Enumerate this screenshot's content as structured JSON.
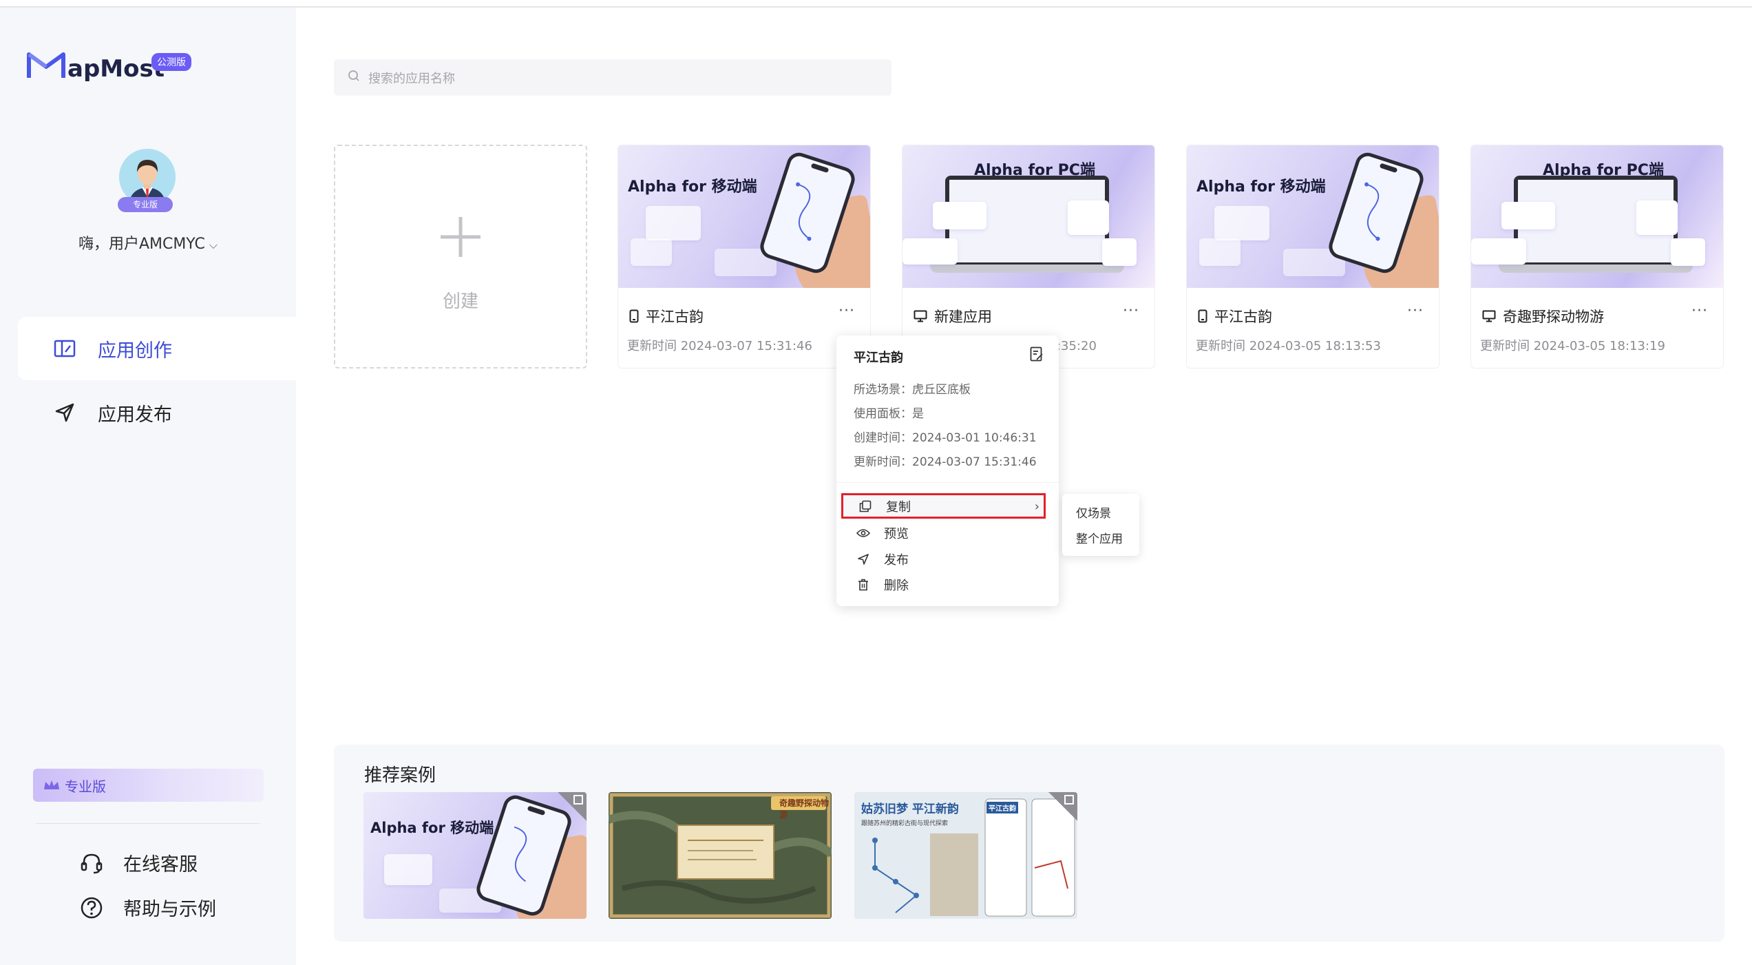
{
  "brand": {
    "logo_text": "apMost",
    "badge": "公测版",
    "accent": "#3d4bd6"
  },
  "user": {
    "greeting": "嗨，用户AMCMYC",
    "tier_tag": "专业版"
  },
  "sidebar": {
    "nav": [
      {
        "label": "应用创作",
        "icon": "app-create-icon",
        "active": true
      },
      {
        "label": "应用发布",
        "icon": "send-icon",
        "active": false
      }
    ],
    "pro_banner": "专业版",
    "footer": [
      {
        "label": "在线客服",
        "icon": "headset-icon"
      },
      {
        "label": "帮助与示例",
        "icon": "help-circle-icon"
      }
    ]
  },
  "search": {
    "placeholder": "搜索的应用名称"
  },
  "create": {
    "label": "创建",
    "icon": "plus-icon"
  },
  "apps": [
    {
      "thumb_title": "Alpha for 移动端",
      "kind": "mobile",
      "name": "平江古韵",
      "updated": "更新时间 2024-03-07 15:31:46"
    },
    {
      "thumb_title": "Alpha for PC端",
      "kind": "pc",
      "name": "新建应用",
      "updated": "更新时间 2024-03-07 15:35:20"
    },
    {
      "thumb_title": "Alpha for 移动端",
      "kind": "mobile",
      "name": "平江古韵",
      "updated": "更新时间 2024-03-05 18:13:53"
    },
    {
      "thumb_title": "Alpha for PC端",
      "kind": "pc",
      "name": "奇趣野探动物游",
      "updated": "更新时间 2024-03-05 18:13:19"
    }
  ],
  "more_label": "···",
  "popover": {
    "title": "平江古韵",
    "info": [
      {
        "label": "所选场景：",
        "value": "虎丘区底板"
      },
      {
        "label": "使用面板：",
        "value": "是"
      },
      {
        "label": "创建时间：",
        "value": "2024-03-01 10:46:31"
      },
      {
        "label": "更新时间：",
        "value": "2024-03-07 15:31:46"
      }
    ],
    "menu": [
      {
        "label": "复制",
        "icon": "copy-icon",
        "has_sub": true
      },
      {
        "label": "预览",
        "icon": "eye-icon"
      },
      {
        "label": "发布",
        "icon": "send-icon"
      },
      {
        "label": "删除",
        "icon": "trash-icon"
      }
    ],
    "submenu": [
      "仅场景",
      "整个应用"
    ]
  },
  "recommended": {
    "title": "推荐案例",
    "cases": [
      {
        "thumb_title": "Alpha for 移动端"
      },
      {
        "thumb_title": "奇趣野探动物游"
      },
      {
        "thumb_title": "姑苏旧梦 平江新韵",
        "subtitle": "跟随苏州的精彩古街与现代探索",
        "side_title": "平江古韵"
      }
    ]
  }
}
